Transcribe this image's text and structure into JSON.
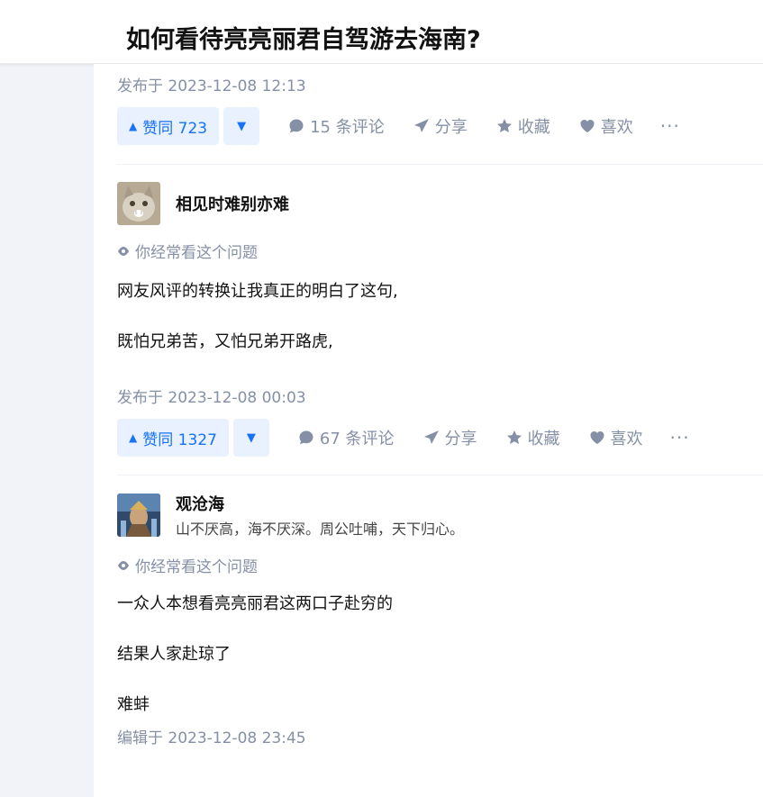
{
  "header": {
    "title": "如何看待亮亮丽君自驾游去海南?"
  },
  "answers": [
    {
      "published": "发布于 2023-12-08 12:13",
      "vote_label": "赞同 723",
      "comments": "15 条评论",
      "share": "分享",
      "collect": "收藏",
      "like": "喜欢",
      "more": "···"
    },
    {
      "author": "相见时难别亦难",
      "watch": "你经常看这个问题",
      "paragraphs": [
        "网友风评的转换让我真正的明白了这句,",
        "既怕兄弟苦，又怕兄弟开路虎,"
      ],
      "published": "发布于 2023-12-08 00:03",
      "vote_label": "赞同 1327",
      "comments": "67 条评论",
      "share": "分享",
      "collect": "收藏",
      "like": "喜欢",
      "more": "···"
    },
    {
      "author": "观沧海",
      "bio": "山不厌高，海不厌深。周公吐哺，天下归心。",
      "watch": "你经常看这个问题",
      "paragraphs": [
        "一众人本想看亮亮丽君这两口子赴穷的",
        "结果人家赴琼了",
        "难蚌"
      ],
      "edited": "编辑于 2023-12-08 23:45"
    }
  ],
  "icons": {
    "vote_up": "triangle-up-icon",
    "vote_down": "triangle-down-icon",
    "comment": "comment-bubble-icon",
    "share": "paper-plane-icon",
    "collect": "star-icon",
    "like": "heart-icon",
    "watch": "eye-icon"
  },
  "colors": {
    "accent": "#1772f6",
    "accent_bg": "#e8f1fd",
    "muted": "#8590a6"
  }
}
